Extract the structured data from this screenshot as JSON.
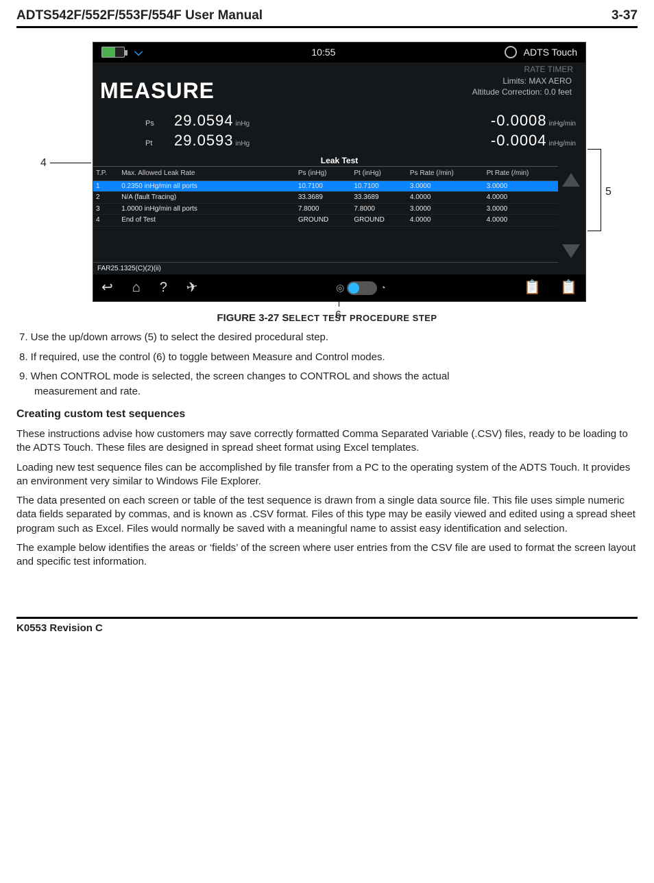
{
  "header": {
    "title": "ADTS542F/552F/553F/554F User Manual",
    "page": "3-37"
  },
  "figure": {
    "callout4": "4",
    "callout5": "5",
    "callout6": "6",
    "caption_prefix": "FIGURE 3-27 S",
    "caption_rest": "ELECT TEST PROCEDURE STEP"
  },
  "device": {
    "status": {
      "time": "10:55",
      "brand": "ADTS Touch"
    },
    "rate_timer_label": "RATE TIMER",
    "measure_label": "MEASURE",
    "limits_line": "Limits: MAX AERO",
    "alt_corr_line": "Altitude Correction: 0.0 feet",
    "readings": {
      "ps_label": "Ps",
      "pt_label": "Pt",
      "ps_val": "29.0594",
      "ps_unit": "inHg",
      "ps_rate": "-0.0008",
      "ps_rate_unit": "inHg/min",
      "pt_val": "29.0593",
      "pt_unit": "inHg",
      "pt_rate": "-0.0004",
      "pt_rate_unit": "inHg/min"
    },
    "leak_test": {
      "title": "Leak Test",
      "headers": {
        "tp": "T.P.",
        "max": "Max. Allowed Leak Rate",
        "ps": "Ps\n(inHg)",
        "pt": "Pt\n(inHg)",
        "psr": "Ps Rate\n(/min)",
        "ptr": "Pt Rate\n(/min)"
      },
      "rows": [
        {
          "tp": "1",
          "max": "0.2350 inHg/min all ports",
          "ps": "10.7100",
          "pt": "10.7100",
          "psr": "3.0000",
          "ptr": "3.0000"
        },
        {
          "tp": "2",
          "max": "N/A  (fault Tracing)",
          "ps": "33.3689",
          "pt": "33.3689",
          "psr": "4.0000",
          "ptr": "4.0000"
        },
        {
          "tp": "3",
          "max": "1.0000 inHg/min all ports",
          "ps": "7.8000",
          "pt": "7.8000",
          "psr": "3.0000",
          "ptr": "3.0000"
        },
        {
          "tp": "4",
          "max": "End of Test",
          "ps": "GROUND",
          "pt": "GROUND",
          "psr": "4.0000",
          "ptr": "4.0000"
        }
      ]
    },
    "ref_line": "FAR25.1325(C)(2)(ii)"
  },
  "body": {
    "step7": "7. Use the up/down arrows (5) to select the desired procedural step.",
    "step8": "8. If required, use the control (6) to toggle between Measure and Control modes.",
    "step9a": "9. When CONTROL mode is selected, the screen changes to CONTROL and shows the actual",
    "step9b": "measurement and rate.",
    "sub_heading": "Creating custom test sequences",
    "p1": "These instructions advise how customers may save correctly formatted Comma Separated Variable (.CSV) files, ready to be loading to the ADTS Touch. These files are designed in spread sheet format using Excel templates.",
    "p2": "Loading new test sequence files can be accomplished by file transfer from a PC to the operating system of the ADTS Touch. It provides an environment very similar to Windows File Explorer.",
    "p3": "The data presented on each screen or table of the test sequence is drawn from a single data source file. This file uses simple numeric data fields separated by commas, and is known as .CSV format. Files of this type may be easily viewed and edited using a spread sheet program such as Excel. Files would normally be saved with a meaningful name to assist easy identification and selection.",
    "p4": "The example below identifies the areas or ‘fields’ of the screen where user entries from the CSV file are used to format the screen layout and specific test information."
  },
  "footer": {
    "rev": "K0553 Revision C"
  }
}
